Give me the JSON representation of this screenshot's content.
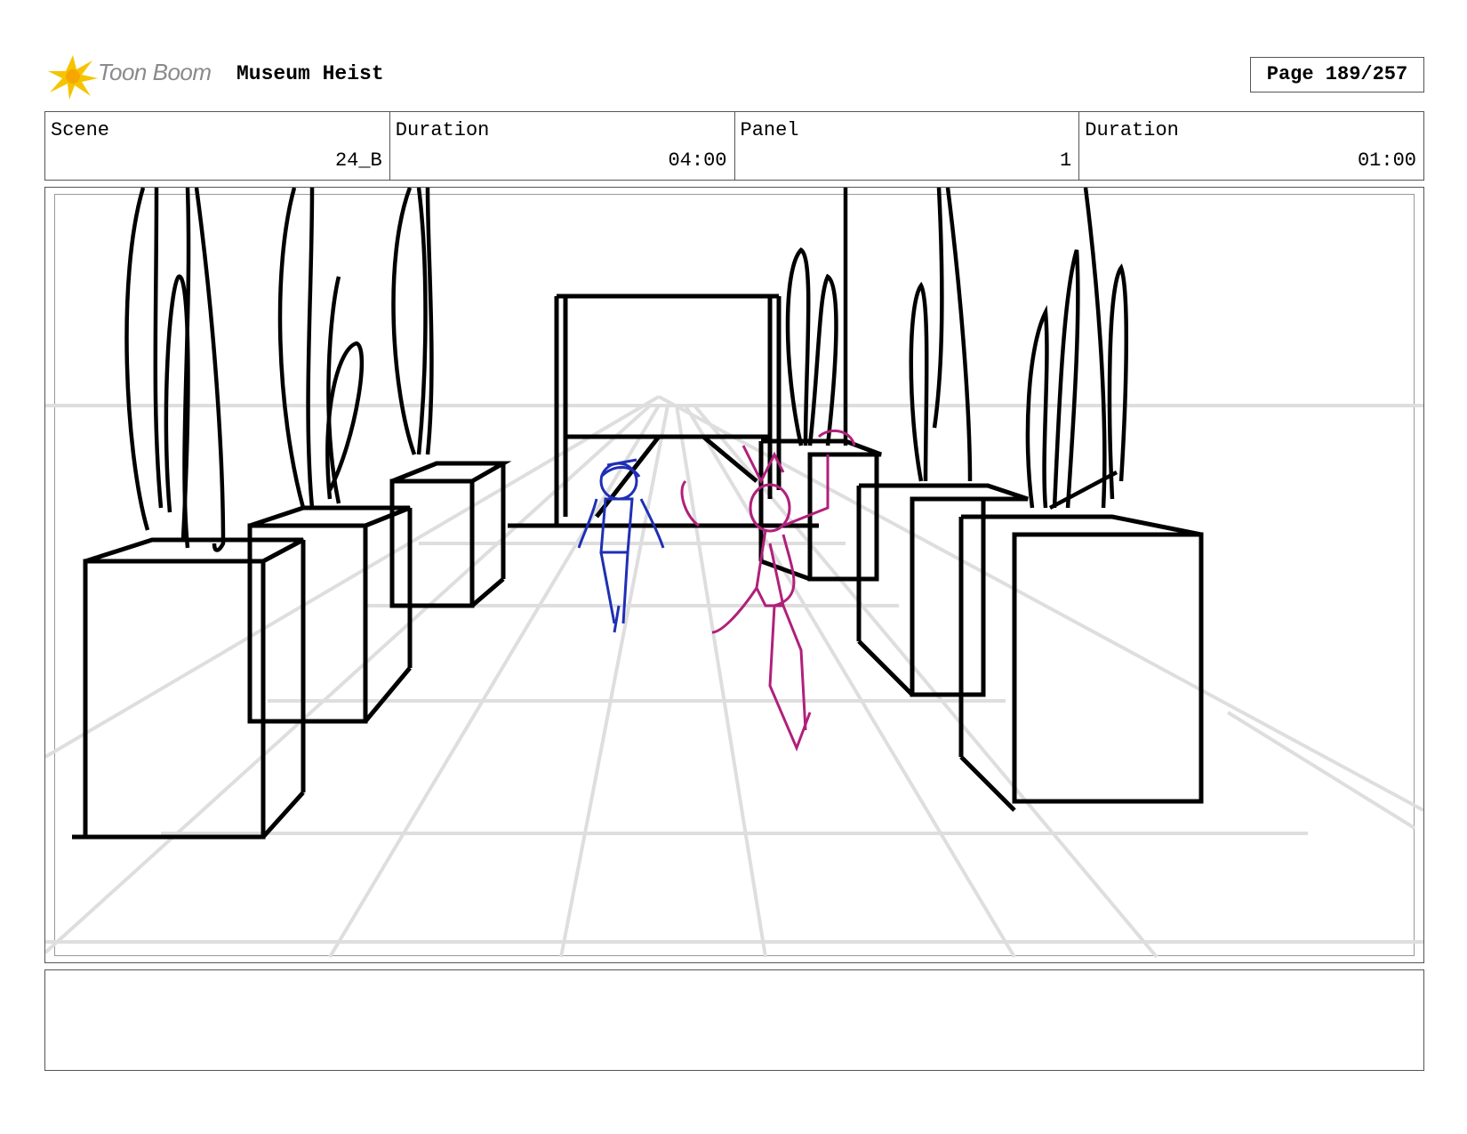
{
  "header": {
    "logo_text": "Toon Boom",
    "project_title": "Museum Heist",
    "page_label": "Page 189/257"
  },
  "info": {
    "scene_label": "Scene",
    "scene_value": "24_B",
    "scene_duration_label": "Duration",
    "scene_duration_value": "04:00",
    "panel_label": "Panel",
    "panel_value": "1",
    "panel_duration_label": "Duration",
    "panel_duration_value": "01:00"
  },
  "notes": {
    "text": ""
  },
  "colors": {
    "character_one": "#1f2fb5",
    "character_two": "#b0207a",
    "ink": "#000000",
    "guide": "#dcdcdc",
    "logo_star": "#f5c400"
  }
}
